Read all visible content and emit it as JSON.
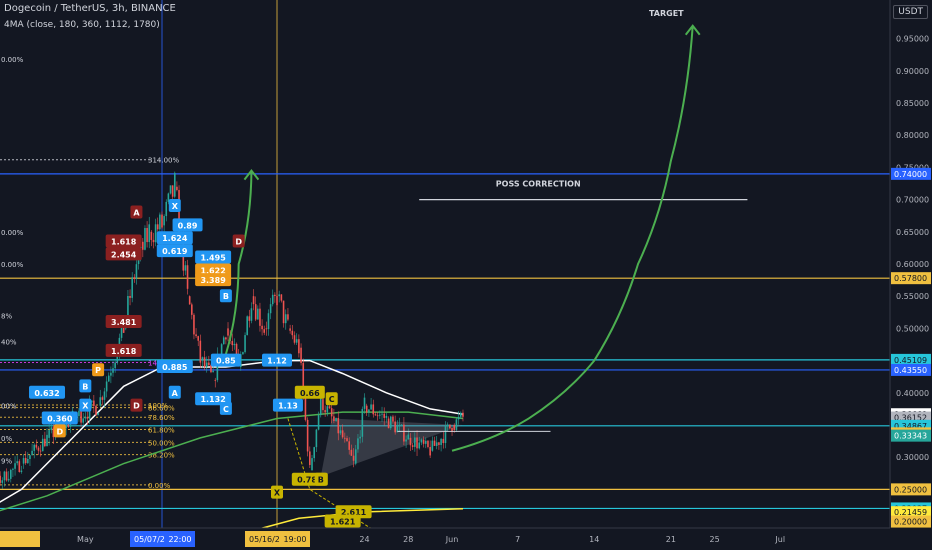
{
  "header": {
    "symbol_line": "Dogecoin / TetherUS, 3h, BINANCE",
    "indicator_line": "4MA (close, 180, 360, 1112, 1780)"
  },
  "currency_button": "USDT",
  "colors": {
    "background": "#131722",
    "axis_text": "#b2b5be",
    "candle_up": "#26a69a",
    "candle_down": "#ef5350",
    "ma_white": "#ffffff",
    "ma_green": "#4caf50",
    "ma_yellow": "#ffeb3b",
    "hline_blue": "#2962ff",
    "hline_cyan": "#26c6da",
    "hline_yellow": "#f0c040",
    "arrow_green": "#4caf50",
    "fib_magenta": "#e040fb",
    "fib_yellow": "#f0c040",
    "wave_label_blue": "#2196f3",
    "wave_label_orange": "#ef9a1a",
    "wave_label_red": "#8b2020"
  },
  "chart_data": {
    "type": "line",
    "y_axis": {
      "min": 0.19,
      "max": 1.01,
      "ticks": [
        0.95,
        0.9,
        0.85,
        0.8,
        0.75,
        0.7,
        0.65,
        0.6,
        0.55,
        0.5,
        0.45,
        0.4,
        0.35,
        0.3,
        0.25,
        0.2
      ]
    },
    "x_axis": {
      "labels": [
        "21",
        "19:00",
        "May",
        "5",
        "24",
        "28",
        "Jun",
        "7",
        "14",
        "21",
        "25",
        "Jul"
      ],
      "highlighted_labels": [
        "05/07/21",
        "22:00",
        "05/16/21",
        "19:00"
      ]
    },
    "price_path": [
      [
        "04/20/21",
        0.2
      ],
      [
        "04/22/21",
        0.28
      ],
      [
        "04/24/21",
        0.26
      ],
      [
        "04/26/21",
        0.29
      ],
      [
        "04/28/21",
        0.33
      ],
      [
        "04/30/21",
        0.36
      ],
      [
        "05/02/21",
        0.38
      ],
      [
        "05/04/21",
        0.5
      ],
      [
        "05/05/21",
        0.6
      ],
      [
        "05/06/21",
        0.65
      ],
      [
        "05/07/21",
        0.66
      ],
      [
        "05/08/21",
        0.72
      ],
      [
        "05/09/21",
        0.55
      ],
      [
        "05/10/21",
        0.45
      ],
      [
        "05/11/21",
        0.42
      ],
      [
        "05/12/21",
        0.5
      ],
      [
        "05/13/21",
        0.44
      ],
      [
        "05/14/21",
        0.55
      ],
      [
        "05/15/21",
        0.5
      ],
      [
        "05/16/21",
        0.55
      ],
      [
        "05/17/21",
        0.5
      ],
      [
        "05/18/21",
        0.47
      ],
      [
        "05/19/21",
        0.28
      ],
      [
        "05/20/21",
        0.39
      ],
      [
        "05/22/21",
        0.33
      ],
      [
        "05/23/21",
        0.29
      ],
      [
        "05/24/21",
        0.38
      ],
      [
        "05/26/21",
        0.36
      ],
      [
        "05/28/21",
        0.33
      ],
      [
        "05/30/21",
        0.31
      ],
      [
        "06/01/21",
        0.35
      ],
      [
        "06/02/21",
        0.36152
      ]
    ],
    "series": [
      {
        "color": "#ffffff",
        "points": [
          [
            "04/20/21",
            0.18
          ],
          [
            "04/26/21",
            0.25
          ],
          [
            "04/30/21",
            0.33
          ],
          [
            "05/04/21",
            0.41
          ],
          [
            "05/07/21",
            0.44
          ],
          [
            "05/12/21",
            0.44
          ],
          [
            "05/16/21",
            0.45
          ],
          [
            "05/19/21",
            0.45
          ],
          [
            "05/22/21",
            0.43
          ],
          [
            "05/26/21",
            0.4
          ],
          [
            "05/30/21",
            0.375
          ],
          [
            "06/02/21",
            0.36669
          ]
        ]
      },
      {
        "color": "#4caf50",
        "points": [
          [
            "04/20/21",
            0.19
          ],
          [
            "04/28/21",
            0.24
          ],
          [
            "05/04/21",
            0.29
          ],
          [
            "05/10/21",
            0.33
          ],
          [
            "05/16/21",
            0.36
          ],
          [
            "05/22/21",
            0.37
          ],
          [
            "05/28/21",
            0.37
          ],
          [
            "06/02/21",
            0.36
          ]
        ]
      },
      {
        "color": "#ffeb3b",
        "points": [
          [
            "05/13/21",
            0.18
          ],
          [
            "05/18/21",
            0.205
          ],
          [
            "05/24/21",
            0.215
          ],
          [
            "06/02/21",
            0.22
          ]
        ]
      }
    ],
    "price_labels": [
      {
        "value": 0.74,
        "label": "0.74000",
        "bg": "#2962ff",
        "fg": "#ffffff"
      },
      {
        "value": 0.578,
        "label": "0.57800",
        "bg": "#f0c040",
        "fg": "#131722"
      },
      {
        "value": 0.45109,
        "label": "0.45109",
        "bg": "#26c6da",
        "fg": "#131722"
      },
      {
        "value": 0.4355,
        "label": "0.43550",
        "bg": "#2962ff",
        "fg": "#ffffff"
      },
      {
        "value": 0.36669,
        "label": "0.36669",
        "bg": "#ffffff",
        "fg": "#131722"
      },
      {
        "value": 0.36152,
        "label": "0.36152",
        "bg": "#b2b5be",
        "fg": "#131722"
      },
      {
        "value": 0.345,
        "label": "01:37:59",
        "bg": "#b2b5be",
        "fg": "#131722"
      },
      {
        "value": 0.34867,
        "label": "0.34867",
        "bg": "#26c6da",
        "fg": "#131722"
      },
      {
        "value": 0.337,
        "label": "0.33700",
        "bg": "#f0c040",
        "fg": "#131722"
      },
      {
        "value": 0.33343,
        "label": "0.33343",
        "bg": "#26a69a",
        "fg": "#ffffff"
      },
      {
        "value": 0.25,
        "label": "0.25000",
        "bg": "#f0c040",
        "fg": "#131722"
      },
      {
        "value": 0.22037,
        "label": "0.22037",
        "bg": "#26c6da",
        "fg": "#131722"
      },
      {
        "value": 0.21459,
        "label": "0.21459",
        "bg": "#ffeb3b",
        "fg": "#131722"
      },
      {
        "value": 0.2,
        "label": "0.20000",
        "bg": "#f0c040",
        "fg": "#131722"
      }
    ],
    "horizontal_lines": [
      {
        "value": 0.74,
        "color": "#2962ff"
      },
      {
        "value": 0.578,
        "color": "#f0c040"
      },
      {
        "value": 0.45109,
        "color": "#26c6da"
      },
      {
        "value": 0.4355,
        "color": "#2962ff"
      },
      {
        "value": 0.34867,
        "color": "#26c6da"
      },
      {
        "value": 0.25,
        "color": "#f0c040"
      },
      {
        "value": 0.22037,
        "color": "#26c6da"
      }
    ],
    "fib_levels_left": [
      {
        "value": 0.762,
        "label": "314.00%"
      },
      {
        "value": 0.447,
        "label": "141.40%"
      },
      {
        "value": 0.381,
        "label": "100%"
      },
      {
        "value": 0.377,
        "label": "86.60%"
      },
      {
        "value": 0.362,
        "label": "78.60%"
      },
      {
        "value": 0.343,
        "label": "61.80%"
      },
      {
        "value": 0.323,
        "label": "50.00%"
      },
      {
        "value": 0.304,
        "label": "38.20%"
      },
      {
        "value": 0.257,
        "label": "0.00%"
      }
    ],
    "left_edge_percent_labels": [
      {
        "value": 0.918,
        "label": "0.00%"
      },
      {
        "value": 0.65,
        "label": "0.00%"
      },
      {
        "value": 0.6,
        "label": "0.00%"
      },
      {
        "value": 0.52,
        "label": "8%"
      },
      {
        "value": 0.48,
        "label": "40%"
      },
      {
        "value": 0.38,
        "label": "00%"
      },
      {
        "value": 0.33,
        "label": "0%"
      },
      {
        "value": 0.295,
        "label": "9%"
      }
    ],
    "annotations": [
      {
        "text": "TARGET",
        "date": "06/19/21",
        "value": 0.985,
        "color": "#d1d4dc"
      },
      {
        "text": "POSS CORRECTION",
        "date": "06/05/21",
        "value": 0.72,
        "color": "#d1d4dc"
      }
    ],
    "wave_labels": [
      {
        "text": "0.89",
        "date": "05/09/21",
        "value": 0.66,
        "bg": "#2196f3"
      },
      {
        "text": "1.495",
        "date": "05/11/21",
        "value": 0.61,
        "bg": "#2196f3"
      },
      {
        "text": "1.624",
        "date": "05/08/21",
        "value": 0.64,
        "bg": "#2196f3"
      },
      {
        "text": "0.619",
        "date": "05/08/21",
        "value": 0.62,
        "bg": "#2196f3"
      },
      {
        "text": "1.622",
        "date": "05/11/21",
        "value": 0.59,
        "bg": "#ef9a1a"
      },
      {
        "text": "3.389",
        "date": "05/11/21",
        "value": 0.575,
        "bg": "#ef9a1a"
      },
      {
        "text": "1.618",
        "date": "05/04/21",
        "value": 0.635,
        "bg": "#8b2020"
      },
      {
        "text": "2.454",
        "date": "05/04/21",
        "value": 0.615,
        "bg": "#8b2020"
      },
      {
        "text": "3.481",
        "date": "05/04/21",
        "value": 0.51,
        "bg": "#8b2020"
      },
      {
        "text": "1.618",
        "date": "05/04/21",
        "value": 0.465,
        "bg": "#8b2020"
      },
      {
        "text": "1.132",
        "date": "05/11/21",
        "value": 0.39,
        "bg": "#2196f3"
      },
      {
        "text": "0.885",
        "date": "05/08/21",
        "value": 0.44,
        "bg": "#2196f3"
      },
      {
        "text": "1.13",
        "date": "05/17/21",
        "value": 0.38,
        "bg": "#2196f3"
      },
      {
        "text": "0.66",
        "date": "05/19/21",
        "value": 0.4,
        "bg": "#c8b400"
      },
      {
        "text": "0.785",
        "date": "05/19/21",
        "value": 0.265,
        "bg": "#c8b400"
      },
      {
        "text": "2.611",
        "date": "05/23/21",
        "value": 0.2145,
        "bg": "#c8b400"
      },
      {
        "text": "1.621",
        "date": "05/22/21",
        "value": 0.2,
        "bg": "#c8b400"
      },
      {
        "text": "0.632",
        "date": "04/28/21",
        "value": 0.4,
        "bg": "#2196f3"
      },
      {
        "text": "0.360",
        "date": "04/29/21",
        "value": 0.36,
        "bg": "#2196f3"
      },
      {
        "text": "1.618",
        "date": "04/21/21",
        "value": 0.36,
        "bg": "#2196f3"
      },
      {
        "text": "0.85",
        "date": "05/12/21",
        "value": 0.45,
        "bg": "#2196f3"
      },
      {
        "text": "1.12",
        "date": "05/16/21",
        "value": 0.45,
        "bg": "#2196f3"
      }
    ],
    "wave_letters": [
      {
        "text": "X",
        "date": "05/08/21",
        "value": 0.69,
        "bg": "#2196f3"
      },
      {
        "text": "D",
        "date": "05/13/21",
        "value": 0.635,
        "bg": "#8b2020"
      },
      {
        "text": "A",
        "date": "05/05/21",
        "value": 0.68,
        "bg": "#8b2020"
      },
      {
        "text": "B",
        "date": "05/12/21",
        "value": 0.55,
        "bg": "#2196f3"
      },
      {
        "text": "C",
        "date": "05/12/21",
        "value": 0.375,
        "bg": "#2196f3"
      },
      {
        "text": "A",
        "date": "05/08/21",
        "value": 0.4,
        "bg": "#2196f3"
      },
      {
        "text": "B",
        "date": "05/01/21",
        "value": 0.41,
        "bg": "#2196f3"
      },
      {
        "text": "P",
        "date": "05/02/21",
        "value": 0.435,
        "bg": "#ef9a1a"
      },
      {
        "text": "X",
        "date": "05/01/21",
        "value": 0.38,
        "bg": "#2196f3"
      },
      {
        "text": "C",
        "date": "05/21/21",
        "value": 0.39,
        "bg": "#c8b400"
      },
      {
        "text": "X",
        "date": "05/16/21",
        "value": 0.245,
        "bg": "#c8b400"
      },
      {
        "text": "B",
        "date": "05/20/21",
        "value": 0.265,
        "bg": "#c8b400"
      },
      {
        "text": "D",
        "date": "05/05/21",
        "value": 0.38,
        "bg": "#8b2020"
      },
      {
        "text": "D",
        "date": "04/29/21",
        "value": 0.34,
        "bg": "#ef9a1a"
      }
    ],
    "vertical_lines": [
      {
        "date": "04/20/21",
        "color": "#f0c040"
      },
      {
        "date": "05/07/21",
        "color": "#2962ff"
      },
      {
        "date": "05/16/21",
        "color": "#f0c040"
      }
    ],
    "target_arrow": [
      [
        "06/01/21",
        0.31
      ],
      [
        "06/08/21",
        0.36
      ],
      [
        "06/14/21",
        0.45
      ],
      [
        "06/18/21",
        0.6
      ],
      [
        "06/21/21",
        0.76
      ],
      [
        "06/23/21",
        0.97
      ]
    ],
    "short_arrow": [
      [
        "05/12/21",
        0.46
      ],
      [
        "05/13/21",
        0.6
      ],
      [
        "05/14/21",
        0.745
      ]
    ],
    "consolidation_line": [
      [
        "05/27/21",
        0.34
      ],
      [
        "06/10/21",
        0.34
      ]
    ],
    "poss_correction_line": [
      [
        "05/29/21",
        0.7
      ],
      [
        "06/28/21",
        0.7
      ]
    ],
    "triangle_shaded": [
      [
        "05/21/21",
        0.36
      ],
      [
        "06/02/21",
        0.35
      ],
      [
        "05/20/21",
        0.27
      ]
    ],
    "triangle_outline": [
      [
        "05/17/21",
        0.36
      ],
      [
        "05/19/21",
        0.25
      ],
      [
        "05/25/21",
        0.185
      ]
    ]
  }
}
